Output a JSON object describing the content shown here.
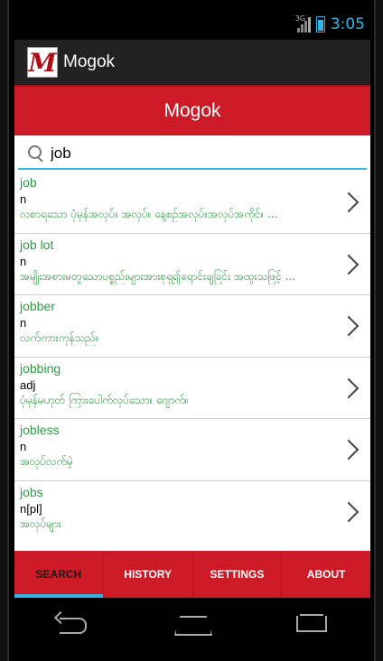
{
  "status_bar": {
    "network": "3G",
    "time": "3:05"
  },
  "action_bar": {
    "logo_letter": "M",
    "title": "Mogok"
  },
  "header": {
    "title": "Mogok"
  },
  "search": {
    "value": "job",
    "placeholder": ""
  },
  "results": [
    {
      "word": "job",
      "pos": "n",
      "definition": "လစာရသော ပုံမှန်အလုပ်။ အလုပ်။ နေ့စဉ်အလုပ်။အလုပ်အကိုင်။ ..."
    },
    {
      "word": "job lot",
      "pos": "n",
      "definition": "အမျိုးအစားမတူသောပစ္စည်းများအားစုရှ၍ရောင်းချခြင်း အထူးသဖြင့် ..."
    },
    {
      "word": "jobber",
      "pos": "n",
      "definition": "လက်ကားကုန်သည်။"
    },
    {
      "word": "jobbing",
      "pos": "adj",
      "definition": "ပုံမှန်မဟုတ် ကြားပေါက်လုပ်သော။ ဂျောက်။"
    },
    {
      "word": "jobless",
      "pos": "n",
      "definition": "အလုပ်လက်မဲ့"
    },
    {
      "word": "jobs",
      "pos": "n[pl]",
      "definition": "အလုပ်များ"
    }
  ],
  "tabs": [
    {
      "label": "SEARCH",
      "active": true
    },
    {
      "label": "HISTORY",
      "active": false
    },
    {
      "label": "SETTINGS",
      "active": false
    },
    {
      "label": "ABOUT",
      "active": false
    }
  ],
  "colors": {
    "brand_red": "#cc1b26",
    "accent_blue": "#33b5e5",
    "word_green": "#2e9a42"
  }
}
